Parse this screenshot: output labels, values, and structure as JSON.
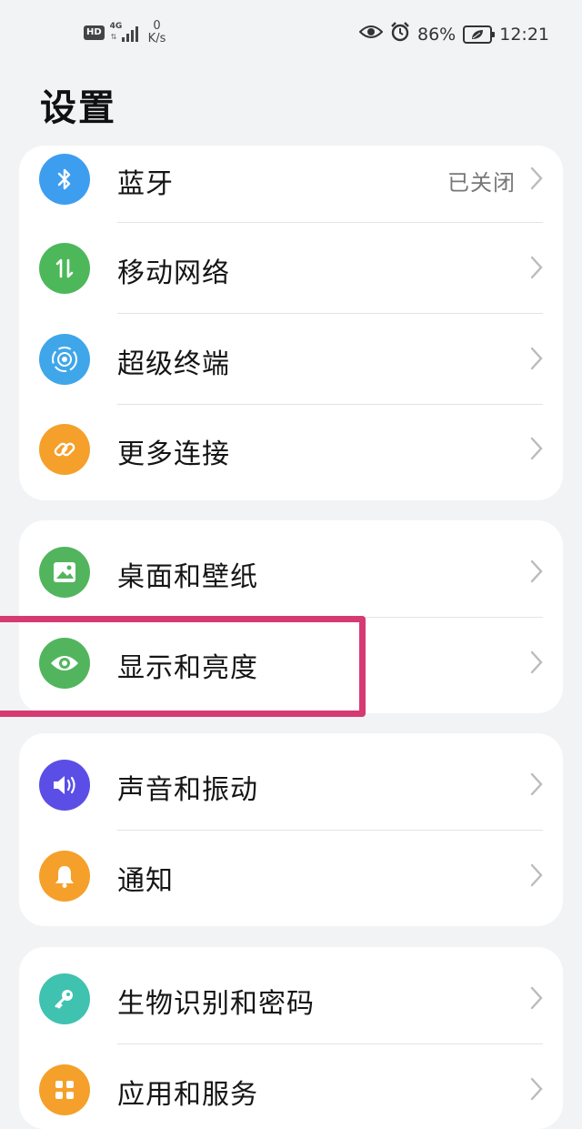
{
  "status_bar": {
    "hd": "HD",
    "network_type": "4G",
    "speed_value": "0",
    "speed_unit": "K/s",
    "battery_percent": "86%",
    "time": "12:21"
  },
  "page_title": "设置",
  "groups": [
    {
      "items": [
        {
          "label": "蓝牙",
          "value": "已关闭",
          "icon": "bluetooth-icon",
          "color": "#3d9ef0"
        },
        {
          "label": "移动网络",
          "icon": "mobile-data-icon",
          "color": "#4cb85a"
        },
        {
          "label": "超级终端",
          "icon": "super-device-icon",
          "color": "#3fa6ea"
        },
        {
          "label": "更多连接",
          "icon": "link-icon",
          "color": "#f5a02a"
        }
      ]
    },
    {
      "items": [
        {
          "label": "桌面和壁纸",
          "icon": "wallpaper-icon",
          "color": "#52b55e"
        },
        {
          "label": "显示和亮度",
          "icon": "eye-icon",
          "color": "#52b55e"
        }
      ]
    },
    {
      "items": [
        {
          "label": "声音和振动",
          "icon": "speaker-icon",
          "color": "#5b4ee6"
        },
        {
          "label": "通知",
          "icon": "bell-icon",
          "color": "#f5a02a"
        }
      ]
    },
    {
      "items": [
        {
          "label": "生物识别和密码",
          "icon": "key-icon",
          "color": "#3fc2b0"
        },
        {
          "label": "应用和服务",
          "icon": "apps-icon",
          "color": "#f5a02a"
        }
      ]
    }
  ],
  "highlight_color": "#d63a73"
}
